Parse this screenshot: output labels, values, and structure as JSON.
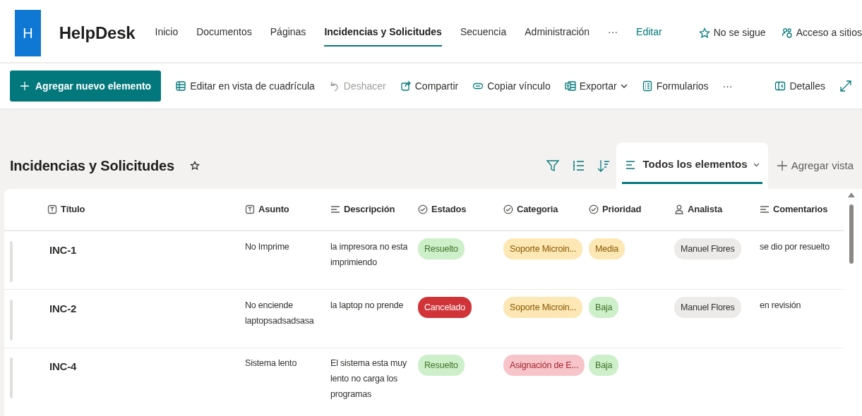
{
  "site": {
    "logo_letter": "H",
    "name": "HelpDesk"
  },
  "nav": [
    {
      "label": "Inicio",
      "selected": false
    },
    {
      "label": "Documentos",
      "selected": false
    },
    {
      "label": "Páginas",
      "selected": false
    },
    {
      "label": "Incidencias y Solicitudes",
      "selected": true
    },
    {
      "label": "Secuencia",
      "selected": false
    },
    {
      "label": "Administración",
      "selected": false
    }
  ],
  "nav_more": "···",
  "nav_edit": "Editar",
  "follow": "No se sigue",
  "site_access": "Acceso a sitios",
  "command_bar": {
    "primary": "Agregar nuevo elemento",
    "items": [
      {
        "label": "Editar en vista de cuadrícula",
        "disabled": false
      },
      {
        "label": "Deshacer",
        "disabled": true
      },
      {
        "label": "Compartir",
        "disabled": false
      },
      {
        "label": "Copiar vínculo",
        "disabled": false
      },
      {
        "label": "Exportar",
        "disabled": false
      },
      {
        "label": "Formularios",
        "disabled": false
      }
    ],
    "more": "···",
    "details": "Detalles"
  },
  "list": {
    "title": "Incidencias y Solicitudes",
    "view": "Todos los elementos",
    "add_view": "Agregar vista"
  },
  "table": {
    "columns": [
      {
        "label": "Título",
        "kind": "text"
      },
      {
        "label": "Asunto",
        "kind": "text"
      },
      {
        "label": "Descripción",
        "kind": "multiline"
      },
      {
        "label": "Estados",
        "kind": "choice"
      },
      {
        "label": "Categoria",
        "kind": "choice"
      },
      {
        "label": "Prioridad",
        "kind": "choice"
      },
      {
        "label": "Analista",
        "kind": "person"
      },
      {
        "label": "Comentarios",
        "kind": "multiline"
      }
    ],
    "rows": [
      {
        "titulo": "INC-1",
        "asunto": "No Imprime",
        "descripcion": "la impresora no esta imprimiendo",
        "estado": {
          "text": "Resuelto",
          "color": "#cdefc9"
        },
        "categoria": {
          "text": "Soporte Microin...",
          "color": "#fde7b5"
        },
        "prioridad": {
          "text": "Media",
          "color": "#fde7b5"
        },
        "analista": "Manuel Flores",
        "comentarios": "se dio por resuelto"
      },
      {
        "titulo": "INC-2",
        "asunto": "No enciende laptopsadsadsasa",
        "descripcion": "la laptop no prende",
        "estado": {
          "text": "Cancelado",
          "color": "#d13438"
        },
        "categoria": {
          "text": "Soporte Microin...",
          "color": "#fde7b5"
        },
        "prioridad": {
          "text": "Baja",
          "color": "#cdefc9"
        },
        "analista": "Manuel Flores",
        "comentarios": "en revisión"
      },
      {
        "titulo": "INC-4",
        "asunto": "Sistema lento",
        "descripcion": "El sistema esta muy lento no carga los programas",
        "estado": {
          "text": "Resuelto",
          "color": "#cdefc9"
        },
        "categoria": {
          "text": "Asignación de E...",
          "color": "#f7c4c9"
        },
        "prioridad": {
          "text": "Baja",
          "color": "#cdefc9"
        }
      }
    ]
  }
}
